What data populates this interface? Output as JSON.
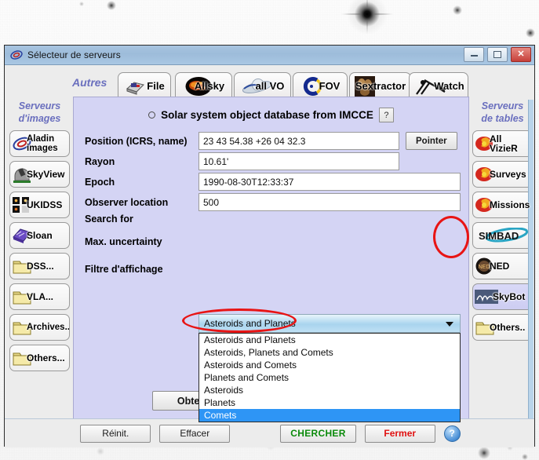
{
  "window": {
    "title": "Sélecteur de serveurs",
    "icon": "aladin-spiral-icon",
    "controls": {
      "minimize": "–",
      "maximize": "□",
      "close": "✕"
    }
  },
  "tabs": {
    "autres_label": "Autres",
    "items": [
      {
        "label": "File",
        "icon": "file-drive-icon"
      },
      {
        "label": "Allsky",
        "icon": "allsky-fireball-icon"
      },
      {
        "label": "all VO",
        "icon": "vo-planet-icon"
      },
      {
        "label": "FOV",
        "icon": "fov-c-icon"
      },
      {
        "label": "Sextractor",
        "icon": "sextractor-thumb-icon"
      },
      {
        "label": "Watch",
        "icon": "watch-telescope-icon"
      }
    ]
  },
  "left_sidebar": {
    "header_line1": "Serveurs",
    "header_line2": "d'images",
    "items": [
      {
        "label": "Aladin images",
        "icon": "aladin-spiral-icon"
      },
      {
        "label": "SkyView",
        "icon": "telescope-dome-icon"
      },
      {
        "label": "UKIDSS",
        "icon": "ukidss-squares-icon"
      },
      {
        "label": "Sloan",
        "icon": "sloan-telescope-icon"
      },
      {
        "label": "DSS...",
        "icon": "folder-icon"
      },
      {
        "label": "VLA...",
        "icon": "folder-icon"
      },
      {
        "label": "Archives...",
        "icon": "folder-icon"
      },
      {
        "label": "Others...",
        "icon": "folder-icon"
      }
    ]
  },
  "right_sidebar": {
    "header_line1": "Serveurs",
    "header_line2": "de tables",
    "items": [
      {
        "label": "All VizieR",
        "icon": "vizier-spiral-icon",
        "selected": false
      },
      {
        "label": "Surveys",
        "icon": "vizier-spiral-icon",
        "selected": false
      },
      {
        "label": "Missions",
        "icon": "vizier-spiral-icon",
        "selected": false
      },
      {
        "label": "SIMBAD",
        "icon": "simbad-icon",
        "selected": false
      },
      {
        "label": "NED",
        "icon": "ned-sphere-icon",
        "selected": false
      },
      {
        "label": "SkyBot",
        "icon": "imcce-icon",
        "selected": true
      },
      {
        "label": "Others..",
        "icon": "folder-icon",
        "selected": false
      }
    ]
  },
  "panel": {
    "radio_selected": false,
    "title": "Solar system object database from IMCCE",
    "help_label": "?",
    "fields": [
      {
        "label": "Position (ICRS, name)",
        "value": "23 43 54.38 +26 04 32.3"
      },
      {
        "label": "Rayon",
        "value": "10.61'"
      },
      {
        "label": "Epoch",
        "value": "1990-08-30T12:33:37"
      },
      {
        "label": "Observer location",
        "value": "500"
      }
    ],
    "pointer_button": "Pointer",
    "search_for": {
      "label": "Search for",
      "selected": "Asteroids and Planets",
      "options": [
        "Asteroids and Planets",
        "Asteroids, Planets and Comets",
        "Asteroids and Comets",
        "Planets and Comets",
        "Asteroids",
        "Planets",
        "Comets"
      ],
      "highlighted_option": "Comets"
    },
    "max_uncertainty_label": "Max. uncertainty",
    "filter_label": "Filtre d'affichage",
    "obtenir_button": "Obtenir les coord. pour"
  },
  "footer": {
    "reinit": "Réinit.",
    "effacer": "Effacer",
    "chercher": "CHERCHER",
    "fermer": "Fermer",
    "help": "?"
  },
  "colors": {
    "panel_background": "#d4d4f4",
    "titlebar": "#a4c2de",
    "highlight_blue": "#2e95f5",
    "annotation_red": "#e81414",
    "chercher_green": "#0a8a0a",
    "fermer_red": "#e01010",
    "sidebar_header": "#6a6fbe"
  }
}
